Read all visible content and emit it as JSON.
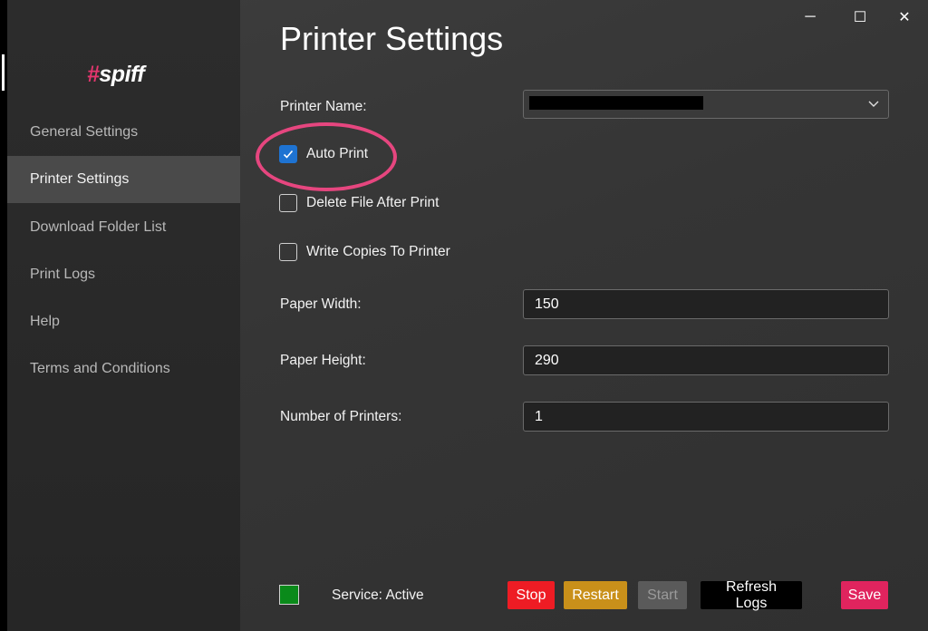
{
  "app": {
    "logo_hash": "#",
    "logo_word": "spiff"
  },
  "window_controls": {
    "minimize": "─",
    "maximize": "☐",
    "close": "✕"
  },
  "sidebar": {
    "items": [
      {
        "label": "General Settings"
      },
      {
        "label": "Printer Settings",
        "active": true
      },
      {
        "label": "Download Folder List"
      },
      {
        "label": "Print Logs"
      },
      {
        "label": "Help"
      },
      {
        "label": "Terms and Conditions"
      }
    ]
  },
  "main": {
    "title": "Printer Settings",
    "printer_name": {
      "label": "Printer Name:",
      "value": ""
    },
    "auto_print": {
      "label": "Auto Print",
      "checked": true
    },
    "delete_file": {
      "label": "Delete File After Print",
      "checked": false
    },
    "write_copies": {
      "label": "Write Copies To Printer",
      "checked": false
    },
    "paper_width": {
      "label": "Paper Width:",
      "value": "150"
    },
    "paper_height": {
      "label": "Paper Height:",
      "value": "290"
    },
    "num_printers": {
      "label": "Number of Printers:",
      "value": "1"
    }
  },
  "footer": {
    "status_color": "#0a8a1a",
    "status_text": "Service: Active",
    "buttons": {
      "stop": {
        "label": "Stop",
        "color": "#ee1c24"
      },
      "restart": {
        "label": "Restart",
        "color": "#c9901a"
      },
      "start": {
        "label": "Start",
        "color": "#5a5a5a"
      },
      "refresh": {
        "label": "Refresh Logs",
        "color": "#000000"
      },
      "save": {
        "label": "Save",
        "color": "#e0245e"
      }
    }
  },
  "colors": {
    "accent_checkbox": "#1e73d2",
    "highlight_circle": "#e6467f"
  }
}
